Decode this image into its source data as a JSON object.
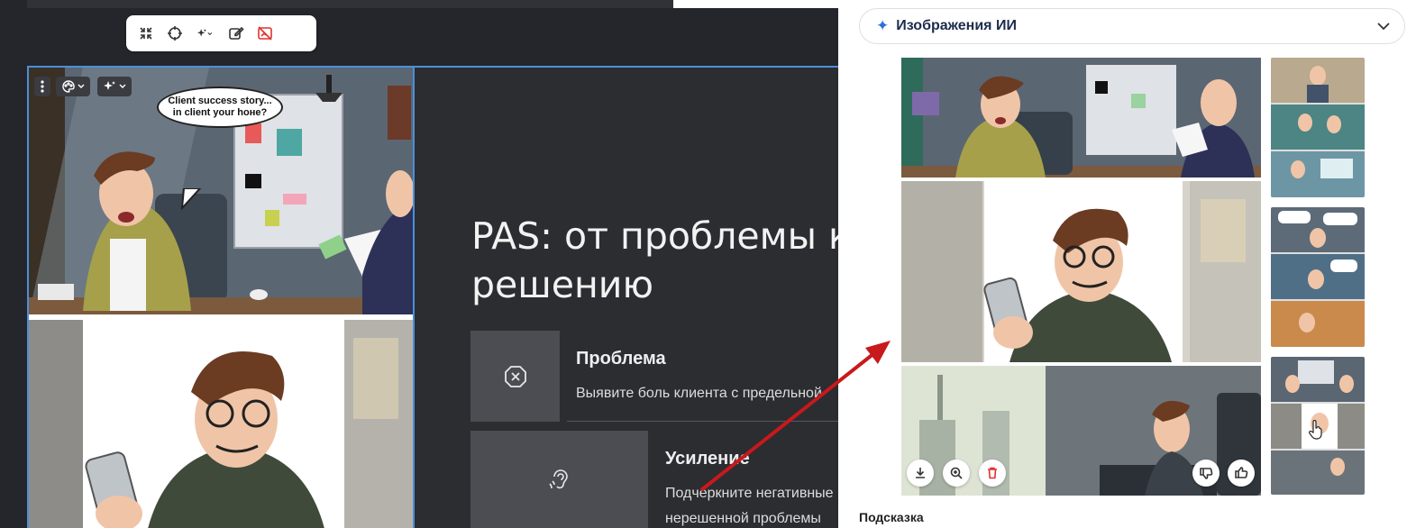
{
  "editor": {
    "toolbar": {
      "icons": [
        "collapse-icon",
        "target-icon",
        "magic-sparkle-icon",
        "edit-pencil-icon",
        "image-off-icon"
      ]
    },
    "image_controls": [
      "menu-dots-icon",
      "palette-icon",
      "magic-sparkle-icon"
    ],
    "comic_speech": "Client success story...\nin client your hoнe?",
    "slide": {
      "title": "PAS: от проблемы к решению",
      "title_line1": "PAS: от проблемы к",
      "title_line2": "решению",
      "cards": [
        {
          "title": "Проблема",
          "text": "Выявите боль клиента с предельной",
          "icon": "close-circle-icon"
        },
        {
          "title": "Усиление",
          "text_line1": "Подчеркните негативные",
          "text_line2": "нерешенной проблемы",
          "icon": "ear-icon"
        }
      ]
    }
  },
  "ai_panel": {
    "dropdown_label": "Изображения ИИ",
    "preview_actions": [
      "download-icon",
      "zoom-in-icon",
      "delete-icon",
      "thumbs-down-icon",
      "thumbs-up-icon"
    ],
    "thumbnails_count": 3,
    "hint_label": "Подсказка"
  },
  "colors": {
    "accent": "#2f6ee0",
    "selection": "#4a90d9",
    "annotation_arrow": "#c8191c",
    "delete": "#e0312f"
  }
}
